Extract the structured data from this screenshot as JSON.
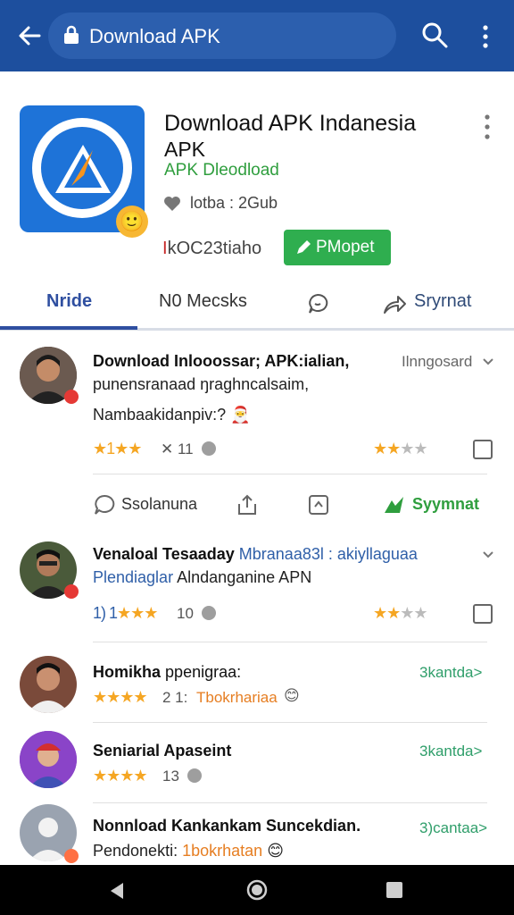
{
  "browser": {
    "url_text": "Download APK"
  },
  "app": {
    "title": "Download APK Indanesia",
    "subtitle": "APK",
    "developer": "APK Dleodload",
    "likes": "lotba : 2Gub",
    "stat_red": "I",
    "stat_text": "kOC23tiaho",
    "primary_button": "PMopet"
  },
  "tabs": [
    {
      "label": "Nride"
    },
    {
      "label": "N0 Mecsks"
    },
    {
      "label": "Sryrnat"
    }
  ],
  "post1": {
    "title_line": "Download Inlooossar; APK:ialian,",
    "line2": "punensranaad ŋraghncalsaim,",
    "line3": "Nambaakidanpiv:?",
    "meta": "Ilnngosard",
    "stars_left": "★1★★",
    "count_left": "✕ 11",
    "stars_right": "★★",
    "stars_right_grey": "★★",
    "emoji": "🎅"
  },
  "actions": {
    "comment": "Ssolanuna",
    "share_green": "Syymnat"
  },
  "post2": {
    "title_bold": "Venaloal Tesaaday",
    "title_blue": "Mbranaa83l : akiyllaguaa",
    "line2_blue": "Plendiaglar",
    "line2_rest": "Alndanganine APN",
    "stars_left_prefix": "1) 1",
    "stars_left": "★★★",
    "count_left": "10",
    "stars_right": "★★",
    "stars_right_grey": "★★"
  },
  "post3": {
    "name": "Homikha",
    "name_rest": "ppenigraa:",
    "stars": "★★★★",
    "count": "2 1:",
    "orange_text": "Tbokrhariaa",
    "emoji": "😊",
    "link": "3kantda>"
  },
  "post4": {
    "name": "Seniarial Apaseint",
    "stars": "★★★★",
    "count": "13",
    "link": "3kantda>"
  },
  "post5": {
    "name": "Nonnload Kankankam Suncekdian.",
    "line2": "Pendonekti:",
    "orange_text": "1bokrhatan",
    "emoji": "😊",
    "link": "3)cantaa>"
  },
  "colors": {
    "appbar": "#1d4f9e",
    "accent_green": "#2fae4f",
    "tab_active": "#2f4fa0",
    "star": "#f5a623"
  }
}
